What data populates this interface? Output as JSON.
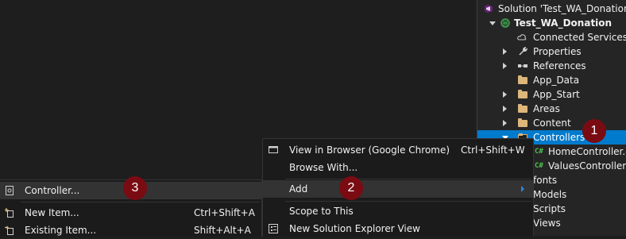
{
  "solution_explorer": {
    "solution_label": "Solution 'Test_WA_Donation'",
    "project_label": "Test_WA_Donation",
    "items": [
      {
        "label": "Connected Services"
      },
      {
        "label": "Properties"
      },
      {
        "label": "References"
      },
      {
        "label": "App_Data"
      },
      {
        "label": "App_Start"
      },
      {
        "label": "Areas"
      },
      {
        "label": "Content"
      },
      {
        "label": "Controllers"
      },
      {
        "label": "HomeController.cs"
      },
      {
        "label": "ValuesController.cs"
      },
      {
        "label": "fonts"
      },
      {
        "label": "Models"
      },
      {
        "label": "Scripts"
      },
      {
        "label": "Views"
      }
    ],
    "cs_tag": "C#"
  },
  "context_menu": {
    "items": [
      {
        "label": "View in Browser (Google Chrome)",
        "shortcut": "Ctrl+Shift+W"
      },
      {
        "label": "Browse With..."
      },
      {
        "label": "Add"
      },
      {
        "label": "Scope to This"
      },
      {
        "label": "New Solution Explorer View"
      }
    ]
  },
  "add_submenu": {
    "items": [
      {
        "label": "Controller..."
      },
      {
        "label": "New Item...",
        "shortcut": "Ctrl+Shift+A"
      },
      {
        "label": "Existing Item...",
        "shortcut": "Shift+Alt+A"
      }
    ]
  },
  "badges": [
    "1",
    "2",
    "3"
  ],
  "colors": {
    "selection": "#007acc",
    "badge": "#7a0b12",
    "folder": "#dcb67a",
    "csharp": "#4ec24e"
  }
}
